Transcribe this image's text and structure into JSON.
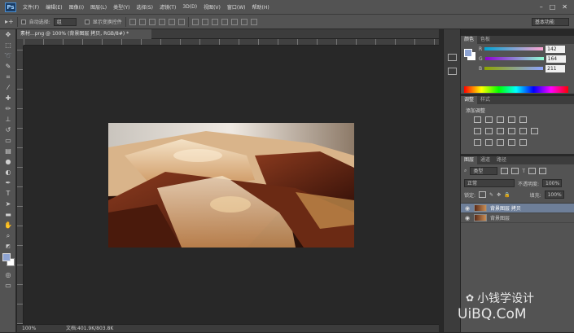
{
  "app": {
    "logo": "Ps"
  },
  "menu": [
    "文件(F)",
    "编辑(E)",
    "图像(I)",
    "图层(L)",
    "类型(Y)",
    "选择(S)",
    "滤镜(T)",
    "3D(D)",
    "视图(V)",
    "窗口(W)",
    "帮助(H)"
  ],
  "window_controls": {
    "minimize": "–",
    "restore": "□",
    "close": "✕"
  },
  "options": {
    "auto_select_label": "自动选择:",
    "auto_select_value": "组",
    "show_transform_label": "显示变换控件",
    "workspace": "基本功能"
  },
  "document": {
    "tab_title": "素材...png @ 100% (背景图层 拷贝, RGB/8#) *",
    "zoom": "100%",
    "doc_size": "文档:401.9K/803.8K"
  },
  "color_panel": {
    "tabs": [
      "颜色",
      "色板"
    ],
    "channels": [
      {
        "label": "R",
        "value": "142"
      },
      {
        "label": "G",
        "value": "164"
      },
      {
        "label": "B",
        "value": "211"
      }
    ],
    "foreground": "#8ea4d3"
  },
  "adjust_panel": {
    "tabs": [
      "调整",
      "样式"
    ],
    "title": "添加调整"
  },
  "layers_panel": {
    "tabs": [
      "图层",
      "通道",
      "路径"
    ],
    "kind_filter": "类型",
    "blend_mode": "正常",
    "opacity_label": "不透明度:",
    "opacity_value": "100%",
    "lock_label": "锁定:",
    "fill_label": "填充:",
    "fill_value": "100%",
    "layers": [
      {
        "name": "背景图层 拷贝",
        "selected": true
      },
      {
        "name": "背景图层",
        "selected": false
      }
    ]
  },
  "watermark": {
    "line1": "小钱学设计",
    "line2": "UiBQ.CoM"
  },
  "tools": [
    "move-tool",
    "marquee-tool",
    "lasso-tool",
    "quick-select-tool",
    "crop-tool",
    "eyedropper-tool",
    "healing-brush-tool",
    "brush-tool",
    "clone-stamp-tool",
    "history-brush-tool",
    "eraser-tool",
    "gradient-tool",
    "blur-tool",
    "dodge-tool",
    "pen-tool",
    "type-tool",
    "path-select-tool",
    "shape-tool",
    "hand-tool",
    "zoom-tool"
  ]
}
